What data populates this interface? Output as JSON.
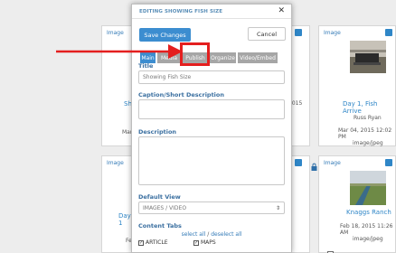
{
  "modal": {
    "title": "EDITING SHOWING FISH SIZE",
    "save_label": "Save Changes",
    "cancel_label": "Cancel",
    "tabs": [
      {
        "label": "Main",
        "active": true
      },
      {
        "label": "Media",
        "active": false
      },
      {
        "label": "Publish",
        "active": false
      },
      {
        "label": "Organize",
        "active": false
      },
      {
        "label": "Video/Embed",
        "active": false
      }
    ],
    "title_label": "Title",
    "title_value": "Showing Fish Size",
    "caption_label": "Caption/Short Description",
    "description_label": "Description",
    "default_view_label": "Default View",
    "default_view_value": "IMAGES / VIDEO",
    "content_tabs_label": "Content Tabs",
    "select_all": "select all",
    "separator": "/",
    "deselect_all": "deselect all",
    "checkboxes": [
      "ARTICLE",
      "MAPS"
    ]
  },
  "cards": {
    "c1": {
      "type": "Image",
      "title_partial": "Sh",
      "meta_partial": "Mar"
    },
    "c2": {
      "type": "Image",
      "title": "Day 1, Fish Arrive",
      "author": "Russ Ryan",
      "date": "Mar 04, 2015 12:02 PM",
      "mime": "image/jpeg",
      "date_partial": "2015"
    },
    "c3": {
      "type": "Image",
      "title_partial": "Day 1",
      "meta_partial": "Fe"
    },
    "c4": {
      "type": "Image",
      "title": "Knaggs Ranch",
      "date": "Feb 18, 2015 11:26 AM",
      "mime": "image/jpeg"
    }
  },
  "colors": {
    "accent": "#3c8dd0",
    "highlight": "#e41f1f",
    "tab_inactive": "#a6a6a6"
  }
}
